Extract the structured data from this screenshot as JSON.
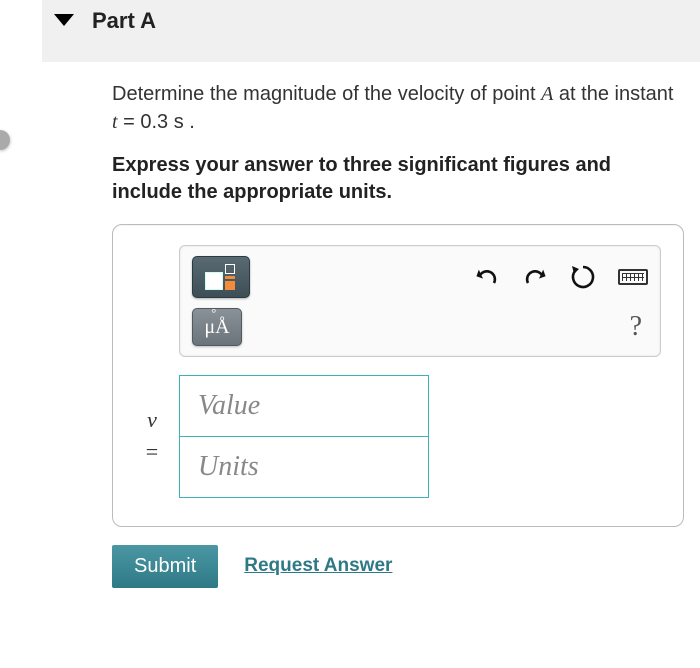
{
  "part": {
    "label": "Part A"
  },
  "question": {
    "line1_pre": "Determine the magnitude of the velocity of point ",
    "point": "A",
    "line1_mid": " at the instant ",
    "var": "t",
    "eq": " = 0.3 s ."
  },
  "instruction": "Express your answer to three significant figures and include the appropriate units.",
  "toolbar": {
    "mu_label": "μÅ",
    "help_label": "?"
  },
  "answer": {
    "lhs_var": "v",
    "lhs_eq": "=",
    "value_placeholder": "Value",
    "units_placeholder": "Units"
  },
  "actions": {
    "submit": "Submit",
    "request": "Request Answer"
  }
}
